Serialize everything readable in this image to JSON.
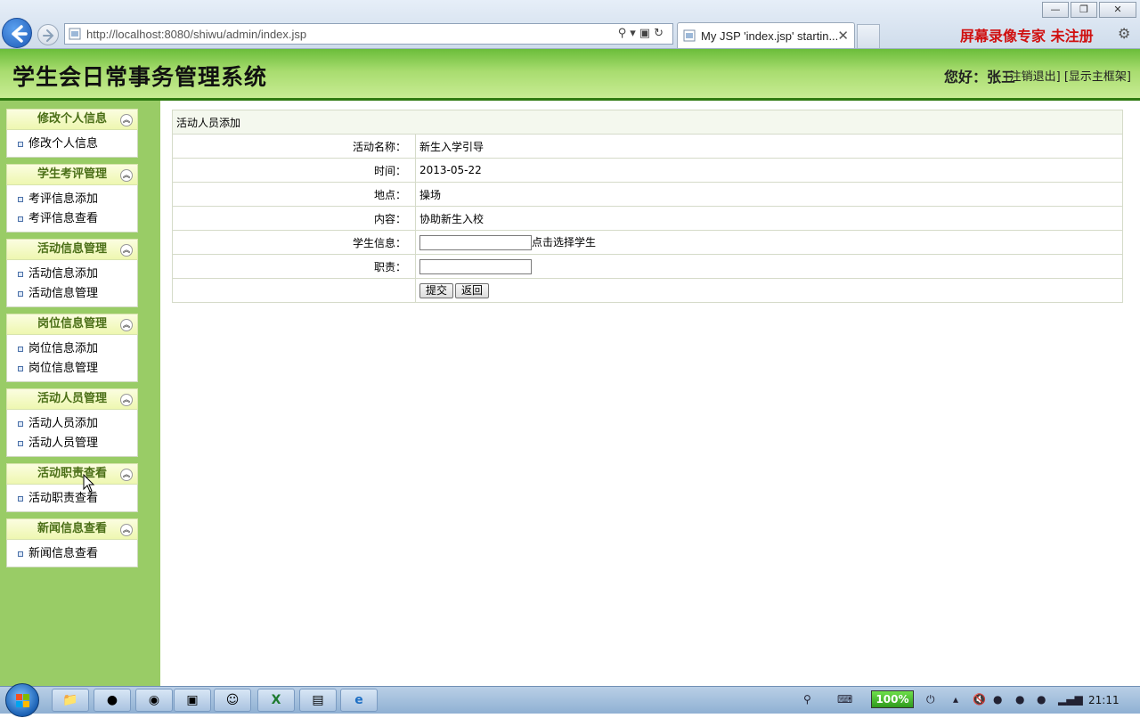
{
  "browser": {
    "url": "http://localhost:8080/shiwu/admin/index.jsp",
    "tab_title": "My JSP 'index.jsp' startin...",
    "watermark": "屏幕录像专家  未注册"
  },
  "header": {
    "title": "学生会日常事务管理系统",
    "greeting": "您好：张三",
    "logout_link": "[注销退出]",
    "show_frame_link": "[显示主框架]"
  },
  "sidebar": {
    "groups": [
      {
        "title": "修改个人信息",
        "items": [
          "修改个人信息"
        ]
      },
      {
        "title": "学生考评管理",
        "items": [
          "考评信息添加",
          "考评信息查看"
        ]
      },
      {
        "title": "活动信息管理",
        "items": [
          "活动信息添加",
          "活动信息管理"
        ]
      },
      {
        "title": "岗位信息管理",
        "items": [
          "岗位信息添加",
          "岗位信息管理"
        ]
      },
      {
        "title": "活动人员管理",
        "items": [
          "活动人员添加",
          "活动人员管理"
        ]
      },
      {
        "title": "活动职责查看",
        "items": [
          "活动职责查看"
        ]
      },
      {
        "title": "新闻信息查看",
        "items": [
          "新闻信息查看"
        ]
      }
    ]
  },
  "form": {
    "caption": "活动人员添加",
    "rows": [
      {
        "label": "活动名称：",
        "value": "新生入学引导"
      },
      {
        "label": "时间：",
        "value": "2013-05-22"
      },
      {
        "label": "地点：",
        "value": "操场"
      },
      {
        "label": "内容：",
        "value": "协助新生入校"
      }
    ],
    "student_label": "学生信息：",
    "student_value": "",
    "student_link": "点击选择学生",
    "duty_label": "职责：",
    "duty_value": "",
    "submit_label": "提交",
    "back_label": "返回"
  },
  "taskbar": {
    "battery": "100%",
    "clock": "21:11"
  }
}
